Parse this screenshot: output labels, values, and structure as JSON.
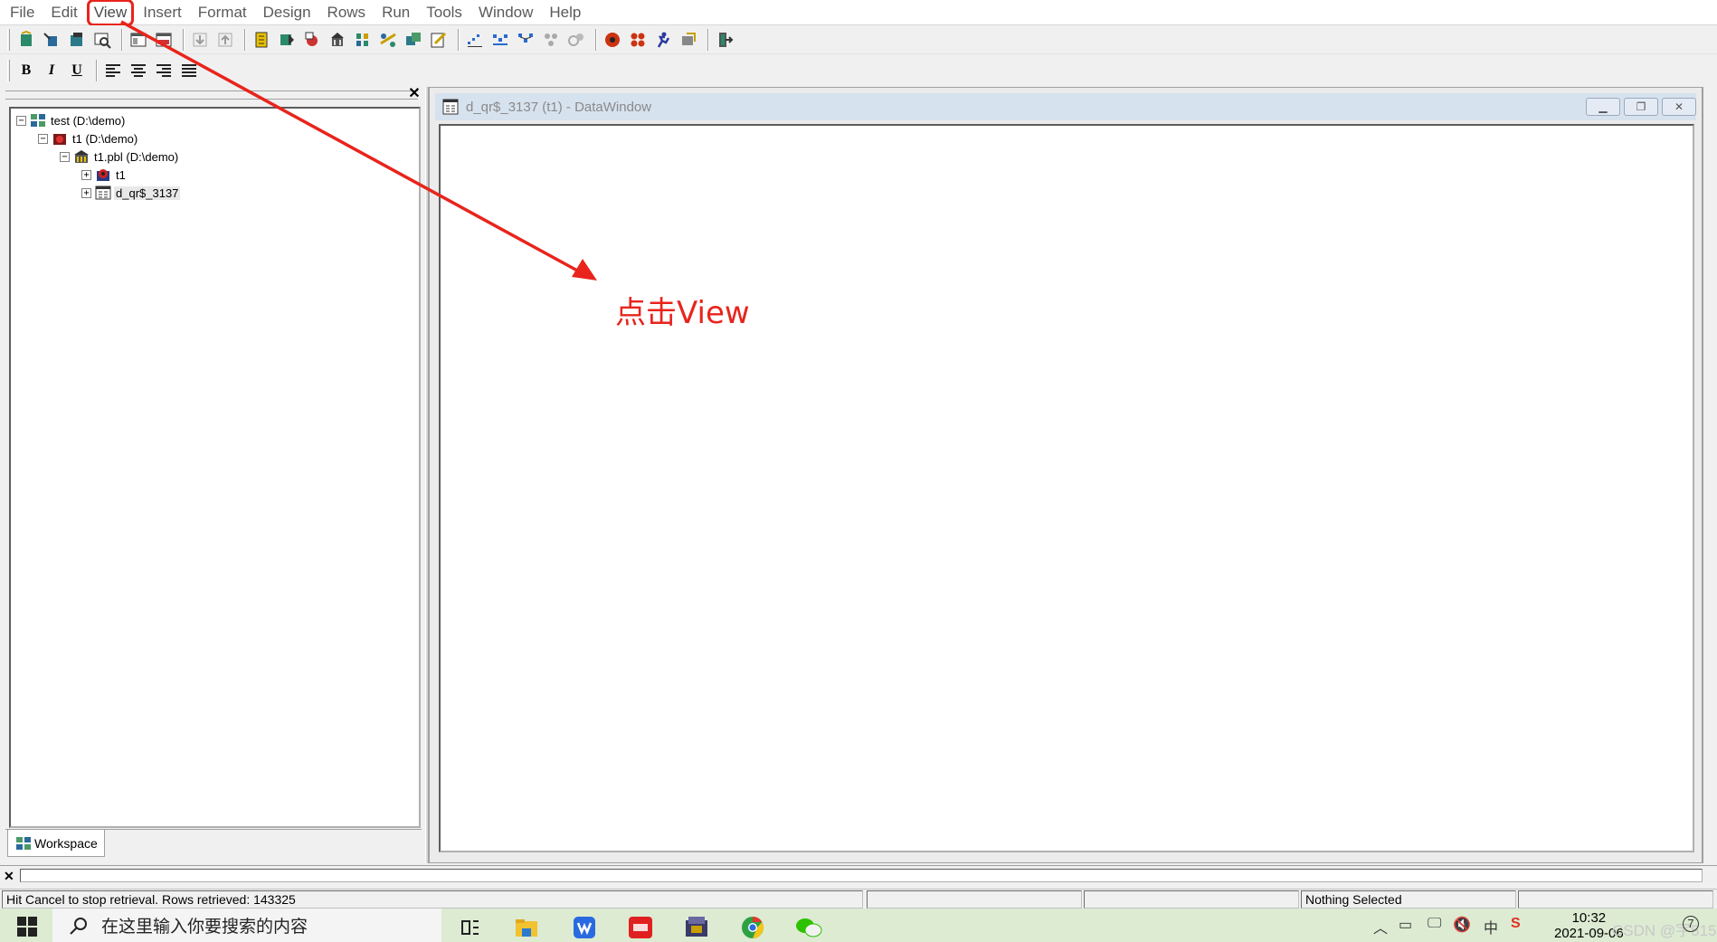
{
  "menu": [
    "File",
    "Edit",
    "View",
    "Insert",
    "Format",
    "Design",
    "Rows",
    "Run",
    "Tools",
    "Window",
    "Help"
  ],
  "menu_highlight_color": "#e8241c",
  "toolbar2": {
    "bold": "B",
    "italic": "I",
    "underline": "U"
  },
  "workspace": {
    "tree": [
      {
        "label": "test (D:\\demo)",
        "expander": "−",
        "icon": "workspace-icon"
      },
      {
        "label": "t1 (D:\\demo)",
        "expander": "−",
        "icon": "target-icon"
      },
      {
        "label": "t1.pbl (D:\\demo)",
        "expander": "−",
        "icon": "library-icon"
      },
      {
        "label": "t1",
        "expander": "+",
        "icon": "application-icon"
      },
      {
        "label": "d_qr$_3137",
        "expander": "+",
        "icon": "datawindow-icon"
      }
    ],
    "tab_label": "Workspace"
  },
  "datawindow": {
    "title": "d_qr$_3137  (t1) - DataWindow",
    "title_bar_color": "#d7e2ef"
  },
  "status": {
    "message": "Hit Cancel to stop retrieval.  Rows retrieved: 143325",
    "selection": "Nothing Selected"
  },
  "taskbar": {
    "search_placeholder": "在这里输入你要搜索的内容",
    "input_method": "中",
    "time": "10:32",
    "date": "2021-09-06",
    "notification_count": "7",
    "watermark": "CSDN @宇515蕾"
  },
  "annotation": {
    "text": "点击View",
    "color": "#e8241c"
  }
}
